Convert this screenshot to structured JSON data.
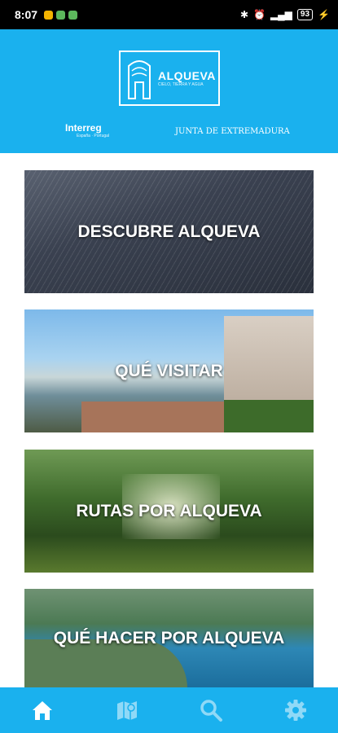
{
  "status_bar": {
    "time": "8:07",
    "battery": "93"
  },
  "header": {
    "logo": {
      "name": "ALQUEVA",
      "tagline": "CIELO, TIERRA Y AGUA"
    },
    "partners": {
      "interreg": {
        "name": "Interreg",
        "sub": "España · Portugal"
      },
      "junta": "JUNTA DE EXTREMADURA"
    }
  },
  "cards": [
    {
      "title": "DESCUBRE ALQUEVA"
    },
    {
      "title": "QUÉ VISITAR"
    },
    {
      "title": "RUTAS POR ALQUEVA"
    },
    {
      "title": "QUÉ HACER POR ALQUEVA"
    }
  ],
  "tabbar": {
    "items": [
      {
        "icon": "home-icon",
        "active": true
      },
      {
        "icon": "map-icon"
      },
      {
        "icon": "search-icon"
      },
      {
        "icon": "gear-icon"
      }
    ]
  },
  "colors": {
    "brand": "#1ab1ee",
    "active_tab": "#ffffff",
    "inactive_tab": "#8fd9f7"
  }
}
